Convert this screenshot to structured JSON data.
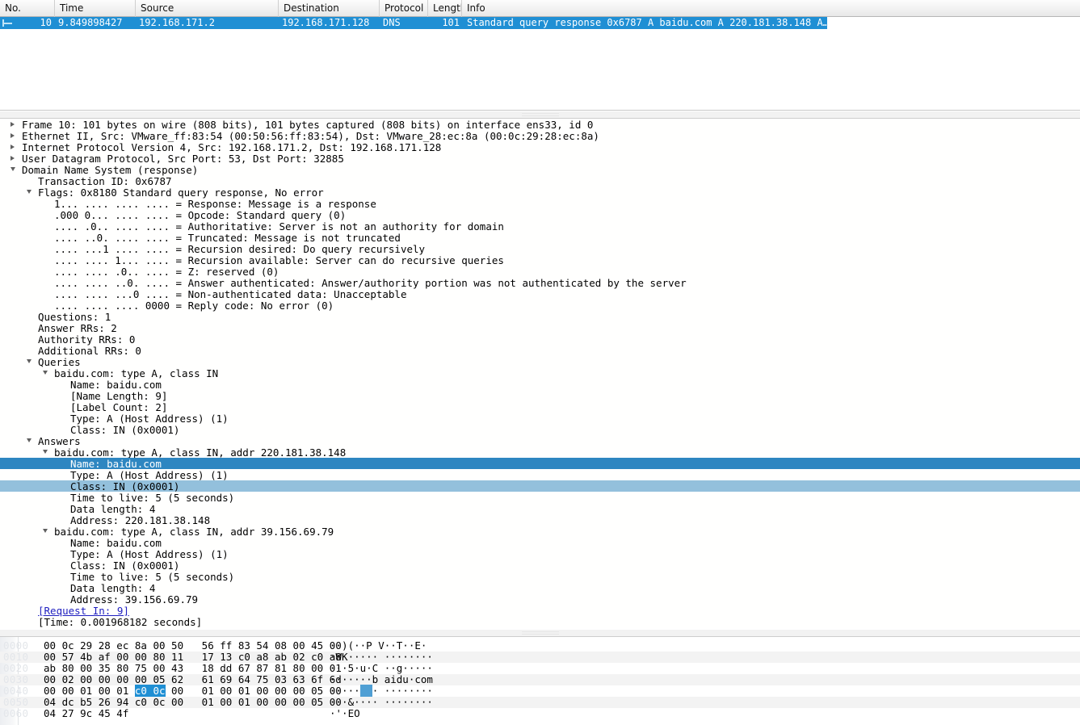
{
  "packet_list": {
    "columns": [
      {
        "label": "No."
      },
      {
        "label": "Time"
      },
      {
        "label": "Source"
      },
      {
        "label": "Destination"
      },
      {
        "label": "Protocol"
      },
      {
        "label": "Length"
      },
      {
        "label": "Info"
      }
    ],
    "selected_row": {
      "no": "10",
      "time": "9.849898427",
      "source": "192.168.171.2",
      "destination": "192.168.171.128",
      "protocol": "DNS",
      "length": "101",
      "info": "Standard query response 0x6787 A baidu.com A 220.181.38.148 A…"
    }
  },
  "detail_tree": [
    {
      "indent": 0,
      "twig": "right",
      "text": "Frame 10: 101 bytes on wire (808 bits), 101 bytes captured (808 bits) on interface ens33, id 0",
      "style": "normal"
    },
    {
      "indent": 0,
      "twig": "right",
      "text": "Ethernet II, Src: VMware_ff:83:54 (00:50:56:ff:83:54), Dst: VMware_28:ec:8a (00:0c:29:28:ec:8a)",
      "style": "normal"
    },
    {
      "indent": 0,
      "twig": "right",
      "text": "Internet Protocol Version 4, Src: 192.168.171.2, Dst: 192.168.171.128",
      "style": "normal"
    },
    {
      "indent": 0,
      "twig": "right",
      "text": "User Datagram Protocol, Src Port: 53, Dst Port: 32885",
      "style": "normal"
    },
    {
      "indent": 0,
      "twig": "down",
      "text": "Domain Name System (response)",
      "style": "normal"
    },
    {
      "indent": 1,
      "twig": "none",
      "text": "Transaction ID: 0x6787",
      "style": "normal"
    },
    {
      "indent": 1,
      "twig": "down",
      "text": "Flags: 0x8180 Standard query response, No error",
      "style": "normal"
    },
    {
      "indent": 2,
      "twig": "none",
      "text": "1... .... .... .... = Response: Message is a response",
      "style": "normal"
    },
    {
      "indent": 2,
      "twig": "none",
      "text": ".000 0... .... .... = Opcode: Standard query (0)",
      "style": "normal"
    },
    {
      "indent": 2,
      "twig": "none",
      "text": ".... .0.. .... .... = Authoritative: Server is not an authority for domain",
      "style": "normal"
    },
    {
      "indent": 2,
      "twig": "none",
      "text": ".... ..0. .... .... = Truncated: Message is not truncated",
      "style": "normal"
    },
    {
      "indent": 2,
      "twig": "none",
      "text": ".... ...1 .... .... = Recursion desired: Do query recursively",
      "style": "normal"
    },
    {
      "indent": 2,
      "twig": "none",
      "text": ".... .... 1... .... = Recursion available: Server can do recursive queries",
      "style": "normal"
    },
    {
      "indent": 2,
      "twig": "none",
      "text": ".... .... .0.. .... = Z: reserved (0)",
      "style": "normal"
    },
    {
      "indent": 2,
      "twig": "none",
      "text": ".... .... ..0. .... = Answer authenticated: Answer/authority portion was not authenticated by the server",
      "style": "normal"
    },
    {
      "indent": 2,
      "twig": "none",
      "text": ".... .... ...0 .... = Non-authenticated data: Unacceptable",
      "style": "normal"
    },
    {
      "indent": 2,
      "twig": "none",
      "text": ".... .... .... 0000 = Reply code: No error (0)",
      "style": "normal"
    },
    {
      "indent": 1,
      "twig": "none",
      "text": "Questions: 1",
      "style": "normal"
    },
    {
      "indent": 1,
      "twig": "none",
      "text": "Answer RRs: 2",
      "style": "normal"
    },
    {
      "indent": 1,
      "twig": "none",
      "text": "Authority RRs: 0",
      "style": "normal"
    },
    {
      "indent": 1,
      "twig": "none",
      "text": "Additional RRs: 0",
      "style": "normal"
    },
    {
      "indent": 1,
      "twig": "down",
      "text": "Queries",
      "style": "normal"
    },
    {
      "indent": 2,
      "twig": "down",
      "text": "baidu.com: type A, class IN",
      "style": "normal"
    },
    {
      "indent": 3,
      "twig": "none",
      "text": "Name: baidu.com",
      "style": "normal"
    },
    {
      "indent": 3,
      "twig": "none",
      "text": "[Name Length: 9]",
      "style": "normal"
    },
    {
      "indent": 3,
      "twig": "none",
      "text": "[Label Count: 2]",
      "style": "normal"
    },
    {
      "indent": 3,
      "twig": "none",
      "text": "Type: A (Host Address) (1)",
      "style": "normal"
    },
    {
      "indent": 3,
      "twig": "none",
      "text": "Class: IN (0x0001)",
      "style": "normal"
    },
    {
      "indent": 1,
      "twig": "down",
      "text": "Answers",
      "style": "normal"
    },
    {
      "indent": 2,
      "twig": "down",
      "text": "baidu.com: type A, class IN, addr 220.181.38.148",
      "style": "normal"
    },
    {
      "indent": 3,
      "twig": "none",
      "text": "Name: baidu.com",
      "style": "selected"
    },
    {
      "indent": 3,
      "twig": "none",
      "text": "Type: A (Host Address) (1)",
      "style": "normal"
    },
    {
      "indent": 3,
      "twig": "none",
      "text": "Class: IN (0x0001)",
      "style": "highlight"
    },
    {
      "indent": 3,
      "twig": "none",
      "text": "Time to live: 5 (5 seconds)",
      "style": "normal"
    },
    {
      "indent": 3,
      "twig": "none",
      "text": "Data length: 4",
      "style": "normal"
    },
    {
      "indent": 3,
      "twig": "none",
      "text": "Address: 220.181.38.148",
      "style": "normal"
    },
    {
      "indent": 2,
      "twig": "down",
      "text": "baidu.com: type A, class IN, addr 39.156.69.79",
      "style": "normal"
    },
    {
      "indent": 3,
      "twig": "none",
      "text": "Name: baidu.com",
      "style": "normal"
    },
    {
      "indent": 3,
      "twig": "none",
      "text": "Type: A (Host Address) (1)",
      "style": "normal"
    },
    {
      "indent": 3,
      "twig": "none",
      "text": "Class: IN (0x0001)",
      "style": "normal"
    },
    {
      "indent": 3,
      "twig": "none",
      "text": "Time to live: 5 (5 seconds)",
      "style": "normal"
    },
    {
      "indent": 3,
      "twig": "none",
      "text": "Data length: 4",
      "style": "normal"
    },
    {
      "indent": 3,
      "twig": "none",
      "text": "Address: 39.156.69.79",
      "style": "normal"
    },
    {
      "indent": 1,
      "twig": "none",
      "text": "[Request In: 9]",
      "style": "link"
    },
    {
      "indent": 1,
      "twig": "none",
      "text": "[Time: 0.001968182 seconds]",
      "style": "normal"
    }
  ],
  "hex_dump": [
    {
      "offset": "0000",
      "bytes_left": "00 0c 29 28 ec 8a 00 50",
      "bytes_right": "56 ff 83 54 08 00 45 00",
      "ascii": "··)(··P V··T··E·",
      "zebra": false
    },
    {
      "offset": "0010",
      "bytes_left": "00 57 4b af 00 00 80 11",
      "bytes_right": "17 13 c0 a8 ab 02 c0 a8",
      "ascii": "·WK····· ········",
      "zebra": true
    },
    {
      "offset": "0020",
      "bytes_left": "ab 80 00 35 80 75 00 43",
      "bytes_right": "18 dd 67 87 81 80 00 01",
      "ascii": "···5·u·C ··g·····",
      "zebra": false
    },
    {
      "offset": "0030",
      "bytes_left": "00 02 00 00 00 00 05 62",
      "bytes_right": "61 69 64 75 03 63 6f 6d",
      "ascii": "·······b aidu·com",
      "zebra": true
    },
    {
      "offset": "0040",
      "bytes_left_pre": "00 00 01 00 01 ",
      "bytes_sel": "c0 0c",
      "bytes_left_post": " 00",
      "bytes_right": "01 00 01 00 00 00 05 00",
      "ascii_pre": "·····",
      "ascii_sel": "··",
      "ascii_post": "· ········",
      "zebra": false,
      "has_selection": true
    },
    {
      "offset": "0050",
      "bytes_left": "04 dc b5 26 94 c0 0c 00",
      "bytes_right": "01 00 01 00 00 00 05 00",
      "ascii": "···&···· ········",
      "zebra": true
    },
    {
      "offset": "0060",
      "bytes_left": "04 27 9c 45 4f",
      "bytes_right": "",
      "ascii": "·'·EO",
      "zebra": false
    }
  ],
  "colors": {
    "selection_blue": "#1f8fd4",
    "tree_selected": "#2e86c1",
    "tree_highlight": "#93c0dc",
    "link_blue": "#2020c0"
  }
}
